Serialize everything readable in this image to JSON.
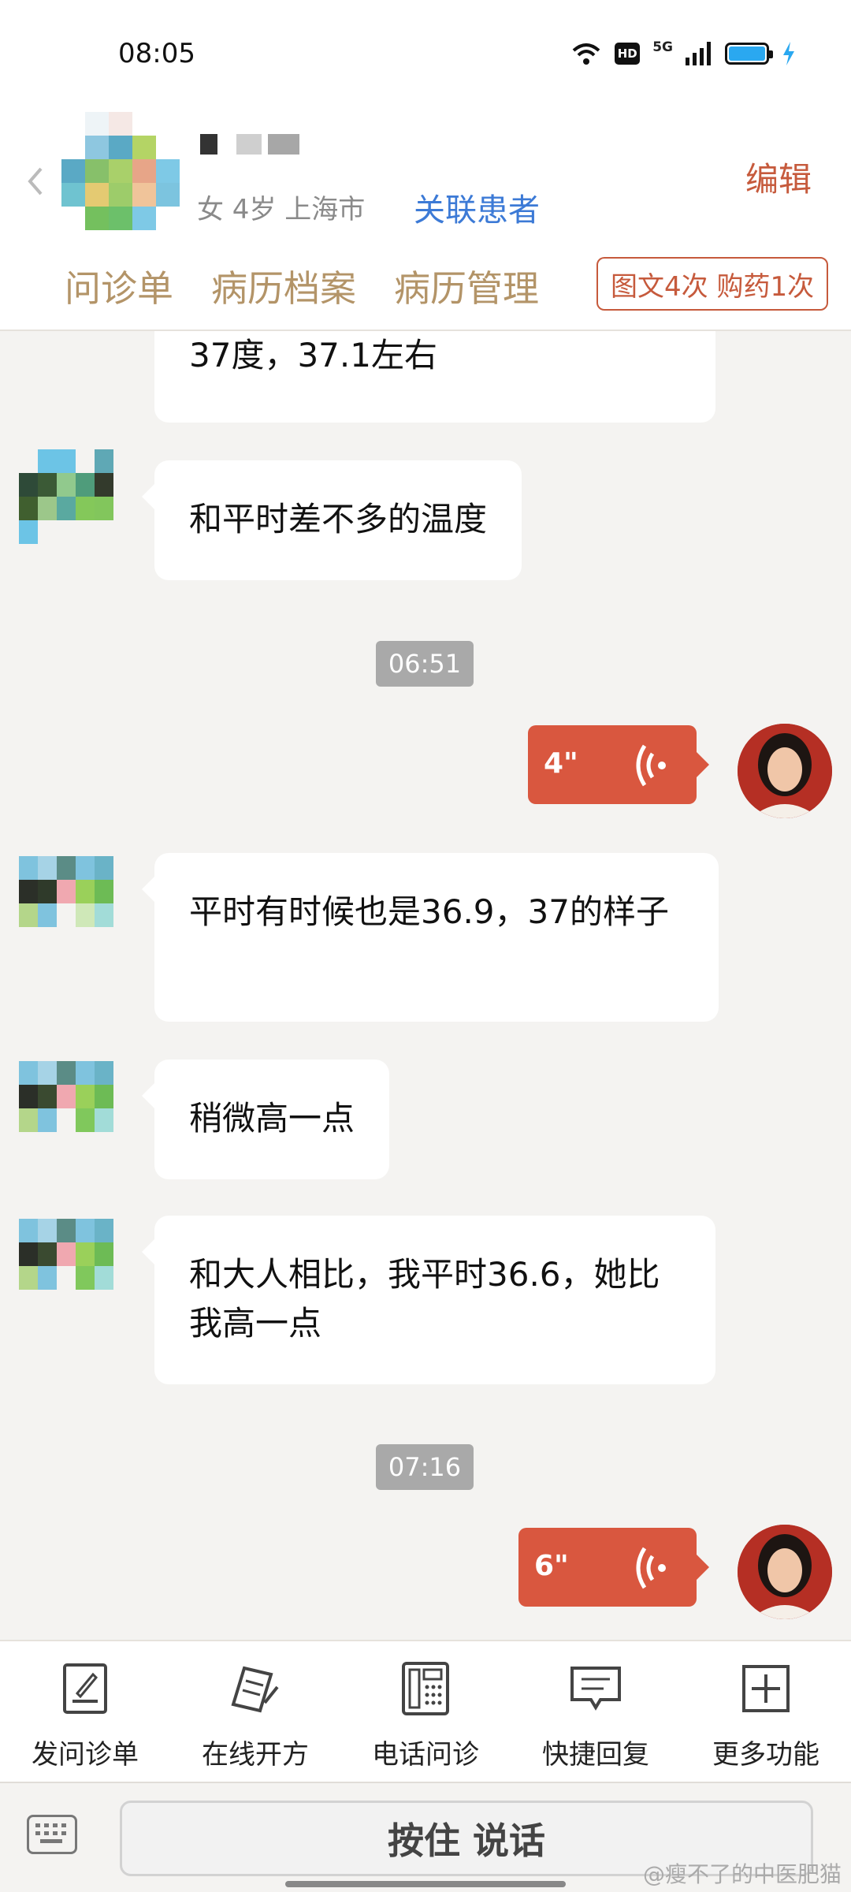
{
  "status": {
    "time": "08:05",
    "hd": "HD",
    "network": "5G",
    "battery_color": "#2aa8f0"
  },
  "patient": {
    "meta": "女 4岁  上海市",
    "link_label": "关联患者",
    "edit_label": "编辑",
    "tabs": [
      "问诊单",
      "病历档案",
      "病历管理"
    ],
    "badge": "图文4次 购药1次"
  },
  "messages": [
    {
      "side": "left",
      "text": "37度，37.1左右"
    },
    {
      "side": "left",
      "text": "和平时差不多的温度"
    },
    {
      "side": "time",
      "text": "06:51"
    },
    {
      "side": "right",
      "voice": "4\""
    },
    {
      "side": "left",
      "text": "平时有时候也是36.9，37的样子"
    },
    {
      "side": "left",
      "text": "稍微高一点"
    },
    {
      "side": "left",
      "text": "和大人相比，我平时36.6，她比我高一点"
    },
    {
      "side": "time",
      "text": "07:16"
    },
    {
      "side": "right",
      "voice": "6\""
    }
  ],
  "toolbar": {
    "items": [
      {
        "label": "发问诊单",
        "icon": "form-icon"
      },
      {
        "label": "在线开方",
        "icon": "prescription-icon"
      },
      {
        "label": "电话问诊",
        "icon": "phone-icon"
      },
      {
        "label": "快捷回复",
        "icon": "quick-reply-icon"
      },
      {
        "label": "更多功能",
        "icon": "more-icon"
      }
    ]
  },
  "input": {
    "talk_label": "按住 说话"
  },
  "watermark": "@瘦不了的中医肥猫",
  "colors": {
    "accent": "#d9573f",
    "tab_text": "#b39468",
    "link": "#3c7ad6",
    "background": "#f4f3f1"
  }
}
